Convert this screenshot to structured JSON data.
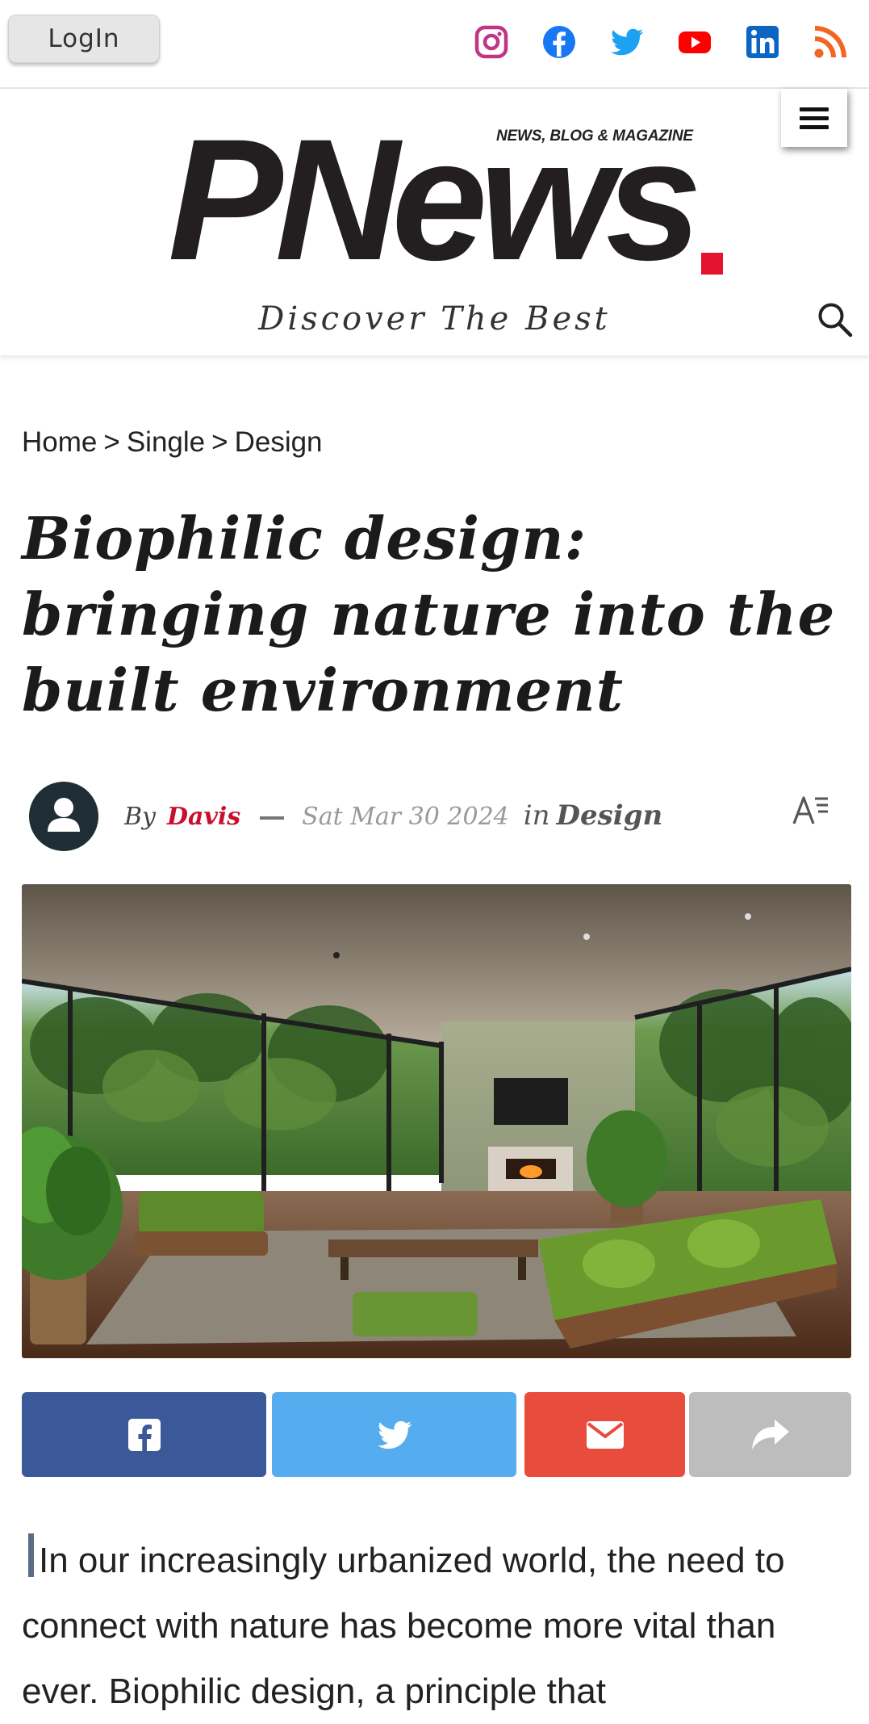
{
  "topbar": {
    "login_label": "LogIn",
    "socials": [
      {
        "name": "instagram-icon",
        "color": "#c13584"
      },
      {
        "name": "facebook-icon",
        "color": "#1877f2"
      },
      {
        "name": "twitter-icon",
        "color": "#1da1f2"
      },
      {
        "name": "youtube-icon",
        "color": "#ff0000"
      },
      {
        "name": "linkedin-icon",
        "color": "#0a66c2"
      },
      {
        "name": "rss-icon",
        "color": "#f26522"
      }
    ]
  },
  "header": {
    "logo_text": "PNews",
    "logo_tagline": "NEWS, BLOG & MAGAZINE",
    "logo_accent_color": "#e4132f",
    "slogan": "Discover The Best"
  },
  "breadcrumb": {
    "items": [
      "Home",
      ">",
      "Single",
      ">",
      "Design"
    ]
  },
  "article": {
    "title": "Biophilic design: bringing nature into the built environment",
    "meta": {
      "by_label": "By",
      "author": "Davis",
      "date": "Sat Mar 30 2024",
      "in_label": "in",
      "category": "Design"
    },
    "hero_alt": "Living room with green sofas, fireplace, and floor-to-ceiling windows facing a forest",
    "share": {
      "facebook_color": "#3b5998",
      "twitter_color": "#55acee",
      "email_color": "#e74c3c",
      "more_color": "#bdbdbd"
    },
    "body_first": "In our increasingly urbanized world, the need to connect with nature has become more vital than ever. Biophilic design, a principle that"
  }
}
